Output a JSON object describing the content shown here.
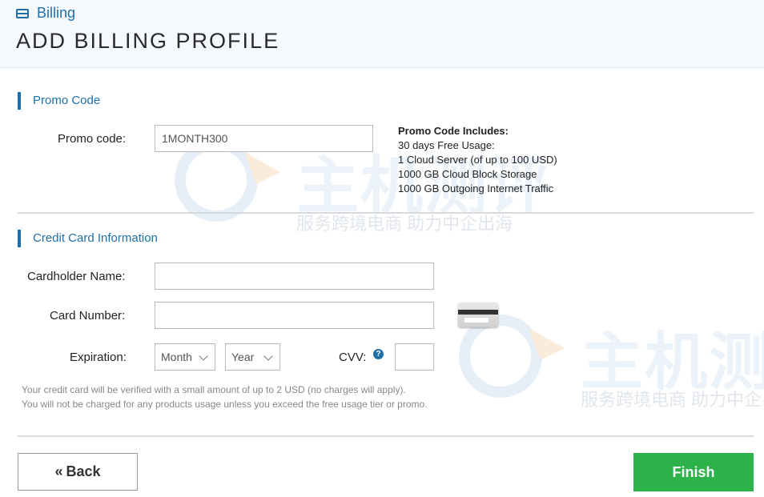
{
  "breadcrumb": {
    "icon": "credit-card-icon",
    "label": "Billing"
  },
  "page_title": "ADD BILLING PROFILE",
  "promo_section": {
    "title": "Promo Code",
    "promo_label": "Promo code:",
    "promo_value": "1MONTH300",
    "includes_heading": "Promo Code Includes:",
    "includes": [
      "30 days Free Usage:",
      "1 Cloud Server (of up to 100 USD)",
      "1000 GB Cloud Block Storage",
      "1000 GB Outgoing Internet Traffic"
    ]
  },
  "card_section": {
    "title": "Credit Card Information",
    "cardholder_label": "Cardholder Name:",
    "cardholder_value": "",
    "card_number_label": "Card Number:",
    "card_number_value": "",
    "expiration_label": "Expiration:",
    "month_value": "Month",
    "year_value": "Year",
    "cvv_label": "CVV:",
    "cvv_help": "?",
    "cvv_value": "",
    "note_1": "Your credit card will be verified with a small amount of up to 2 USD (no charges will apply).",
    "note_2": "You will not be charged for any products usage unless you exceed the free usage tier or promo."
  },
  "actions": {
    "back_label": "Back",
    "back_icon": "«",
    "finish_label": "Finish"
  },
  "watermark": {
    "main": "主机测评",
    "tagline": "服务跨境电商 助力中企出海"
  },
  "colors": {
    "accent": "#1f6fa9",
    "finish": "#2db24a",
    "header_bg": "#f5f8fc"
  }
}
